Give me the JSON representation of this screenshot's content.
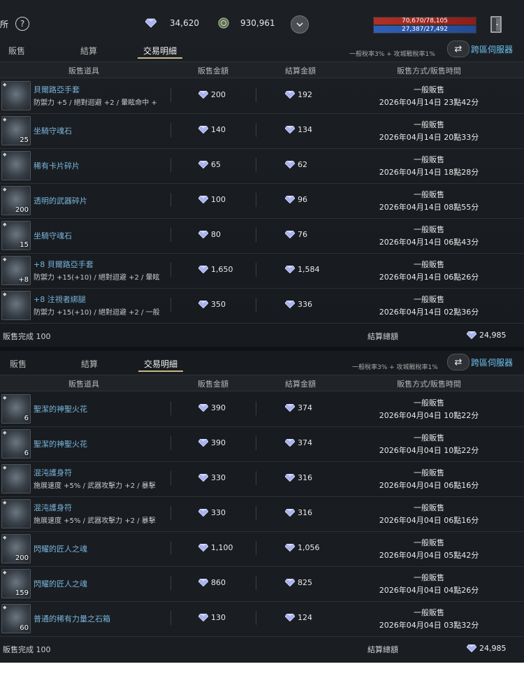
{
  "topbar": {
    "left_label": "所",
    "help": "?",
    "diamonds": "34,620",
    "coins": "930,961",
    "hp": "70,670/78,105",
    "mp": "27,387/27,492"
  },
  "panel_top": {
    "tabs": [
      "販售",
      "結算",
      "交易明細"
    ],
    "tax_text": "一般稅率3% + 攻城戰稅率1%",
    "cross_server": "跨區伺服器",
    "headers": [
      "販售道具",
      "販售金額",
      "結算金額",
      "販售方式/販售時間"
    ],
    "rows": [
      {
        "name": "貝爾路亞手套",
        "desc": "防禦力 +5 / 絕對迴避 +2 / 暈眩命中 +",
        "qty": "",
        "price": "200",
        "settle": "192",
        "method": "一般販售",
        "time": "2026年04月14日 23點42分"
      },
      {
        "name": "坐騎守魂石",
        "desc": "",
        "qty": "25",
        "price": "140",
        "settle": "134",
        "method": "一般販售",
        "time": "2026年04月14日 20點33分"
      },
      {
        "name": "稀有卡片碎片",
        "desc": "",
        "qty": "",
        "price": "65",
        "settle": "62",
        "method": "一般販售",
        "time": "2026年04月14日 18點28分"
      },
      {
        "name": "透明的武器碎片",
        "desc": "",
        "qty": "200",
        "price": "100",
        "settle": "96",
        "method": "一般販售",
        "time": "2026年04月14日 08點55分"
      },
      {
        "name": "坐騎守魂石",
        "desc": "",
        "qty": "15",
        "price": "80",
        "settle": "76",
        "method": "一般販售",
        "time": "2026年04月14日 06點43分"
      },
      {
        "name": "+8 貝爾路亞手套",
        "desc": "防禦力 +15(+10) / 絕對迴避 +2 / 暈眩",
        "qty": "+8",
        "price": "1,650",
        "settle": "1,584",
        "method": "一般販售",
        "time": "2026年04月14日 06點26分"
      },
      {
        "name": "+8 注視者綁腿",
        "desc": "防禦力 +15(+10) / 絕對迴避 +2 / 一般",
        "qty": "",
        "price": "350",
        "settle": "336",
        "method": "一般販售",
        "time": "2026年04月14日 02點36分"
      }
    ],
    "footer_left": "販售完成 100",
    "footer_mid": "結算總額",
    "footer_total": "24,985"
  },
  "panel_bottom": {
    "tabs": [
      "販售",
      "結算",
      "交易明細"
    ],
    "tax_text": "一般稅率3% + 攻城戰稅率1%",
    "cross_server": "跨區伺服器",
    "headers": [
      "販售道具",
      "販售金額",
      "結算金額",
      "販售方式/販售時間"
    ],
    "rows": [
      {
        "name": "聖潔的神聖火花",
        "desc": "",
        "qty": "6",
        "price": "390",
        "settle": "374",
        "method": "一般販售",
        "time": "2026年04月04日 10點22分"
      },
      {
        "name": "聖潔的神聖火花",
        "desc": "",
        "qty": "6",
        "price": "390",
        "settle": "374",
        "method": "一般販售",
        "time": "2026年04月04日 10點22分"
      },
      {
        "name": "混沌護身符",
        "desc": "施展速度 +5% / 武器攻擊力 +2 / 暴擊",
        "qty": "",
        "price": "330",
        "settle": "316",
        "method": "一般販售",
        "time": "2026年04月04日 06點16分"
      },
      {
        "name": "混沌護身符",
        "desc": "施展速度 +5% / 武器攻擊力 +2 / 暴擊",
        "qty": "",
        "price": "330",
        "settle": "316",
        "method": "一般販售",
        "time": "2026年04月04日 06點16分"
      },
      {
        "name": "閃耀的匠人之魂",
        "desc": "",
        "qty": "200",
        "price": "1,100",
        "settle": "1,056",
        "method": "一般販售",
        "time": "2026年04月04日 05點42分"
      },
      {
        "name": "閃耀的匠人之魂",
        "desc": "",
        "qty": "159",
        "price": "860",
        "settle": "825",
        "method": "一般販售",
        "time": "2026年04月04日 04點26分"
      },
      {
        "name": "普通的稀有力量之石箱",
        "desc": "",
        "qty": "60",
        "price": "130",
        "settle": "124",
        "method": "一般販售",
        "time": "2026年04月04日 03點32分"
      }
    ],
    "footer_left": "販售完成 100",
    "footer_mid": "結算總額",
    "footer_total": "24,985"
  }
}
